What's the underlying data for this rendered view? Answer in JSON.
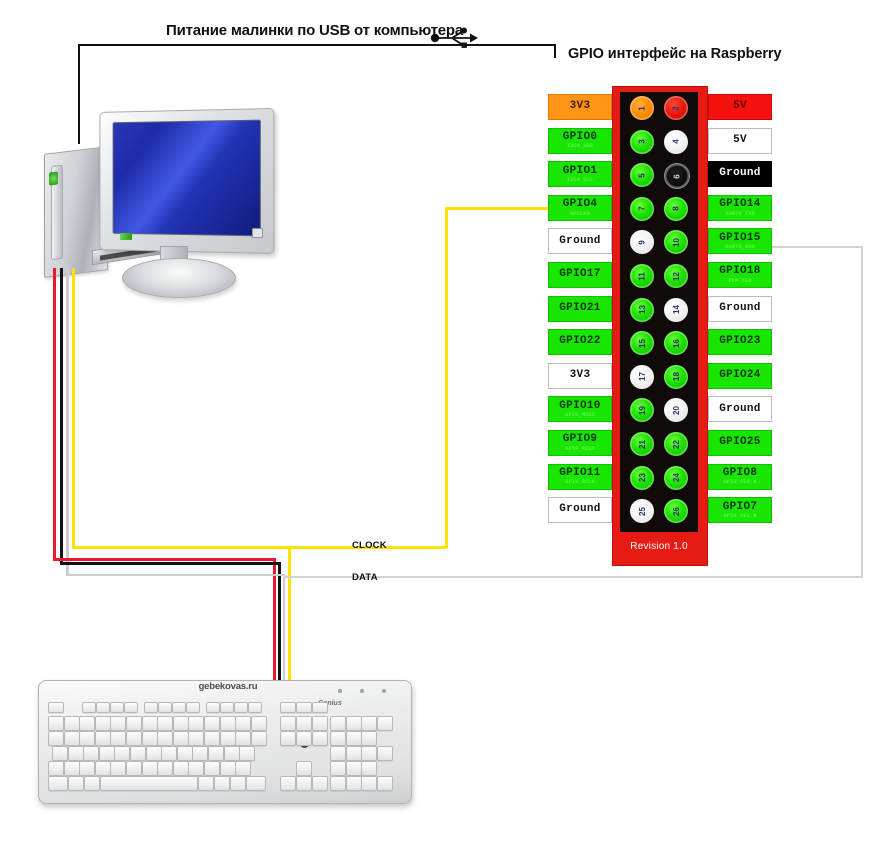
{
  "titles": {
    "usb_power": "Питание малинки по USB от компьютера",
    "gpio_header": "GPIO интерфейс на Raspberry"
  },
  "icons": {
    "usb": "usb-icon"
  },
  "board": {
    "revision": "Revision 1.0",
    "body_color": "#e51b14",
    "inner_color": "#100b09"
  },
  "net_labels": {
    "clock": "CLOCK",
    "data": "DATA"
  },
  "keyboard": {
    "watermark": "gebekovas.ru",
    "brand": "Genius"
  },
  "wire_colors": {
    "red": "#e8192c",
    "black": "#121212",
    "white": "#c9cdd1",
    "yellow": "#ffe200",
    "gray": "#cfd3d6"
  },
  "pins": {
    "left": [
      {
        "num": "1",
        "color": "orange"
      },
      {
        "num": "3",
        "color": "green"
      },
      {
        "num": "5",
        "color": "green"
      },
      {
        "num": "7",
        "color": "green"
      },
      {
        "num": "9",
        "color": "white"
      },
      {
        "num": "11",
        "color": "green"
      },
      {
        "num": "13",
        "color": "green"
      },
      {
        "num": "15",
        "color": "green"
      },
      {
        "num": "17",
        "color": "white"
      },
      {
        "num": "19",
        "color": "green"
      },
      {
        "num": "21",
        "color": "green"
      },
      {
        "num": "23",
        "color": "green"
      },
      {
        "num": "25",
        "color": "white"
      }
    ],
    "right": [
      {
        "num": "2",
        "color": "red"
      },
      {
        "num": "4",
        "color": "white"
      },
      {
        "num": "6",
        "color": "dark"
      },
      {
        "num": "8",
        "color": "green"
      },
      {
        "num": "10",
        "color": "green"
      },
      {
        "num": "12",
        "color": "green"
      },
      {
        "num": "14",
        "color": "white"
      },
      {
        "num": "16",
        "color": "green"
      },
      {
        "num": "18",
        "color": "green"
      },
      {
        "num": "20",
        "color": "white"
      },
      {
        "num": "22",
        "color": "green"
      },
      {
        "num": "24",
        "color": "green"
      },
      {
        "num": "26",
        "color": "green"
      }
    ]
  },
  "labels_left": [
    {
      "main": "3V3",
      "sub": "",
      "style": "lb-orange"
    },
    {
      "main": "GPIO0",
      "sub": "I2C0_SDA",
      "style": "lb-green"
    },
    {
      "main": "GPIO1",
      "sub": "I2C0_SCL",
      "style": "lb-green"
    },
    {
      "main": "GPIO4",
      "sub": "GPCLK0",
      "style": "lb-green"
    },
    {
      "main": "Ground",
      "sub": "",
      "style": "lb-white"
    },
    {
      "main": "GPIO17",
      "sub": "",
      "style": "lb-green"
    },
    {
      "main": "GPIO21",
      "sub": "",
      "style": "lb-green"
    },
    {
      "main": "GPIO22",
      "sub": "",
      "style": "lb-green"
    },
    {
      "main": "3V3",
      "sub": "",
      "style": "lb-white"
    },
    {
      "main": "GPIO10",
      "sub": "SPI0_MOSI",
      "style": "lb-green"
    },
    {
      "main": "GPIO9",
      "sub": "SPI0_MISO",
      "style": "lb-green"
    },
    {
      "main": "GPIO11",
      "sub": "SPI0_SCLK",
      "style": "lb-green"
    },
    {
      "main": "Ground",
      "sub": "",
      "style": "lb-white"
    }
  ],
  "labels_right": [
    {
      "main": "5V",
      "sub": "",
      "style": "lb-red"
    },
    {
      "main": "5V",
      "sub": "",
      "style": "lb-white"
    },
    {
      "main": "Ground",
      "sub": "",
      "style": "lb-black"
    },
    {
      "main": "GPIO14",
      "sub": "UART0_TXD",
      "style": "lb-green"
    },
    {
      "main": "GPIO15",
      "sub": "UART0_RXD",
      "style": "lb-green"
    },
    {
      "main": "GPIO18",
      "sub": "PCM_CLK",
      "style": "lb-green"
    },
    {
      "main": "Ground",
      "sub": "",
      "style": "lb-white"
    },
    {
      "main": "GPIO23",
      "sub": "",
      "style": "lb-green"
    },
    {
      "main": "GPIO24",
      "sub": "",
      "style": "lb-green"
    },
    {
      "main": "Ground",
      "sub": "",
      "style": "lb-white"
    },
    {
      "main": "GPIO25",
      "sub": "",
      "style": "lb-green"
    },
    {
      "main": "GPIO8",
      "sub": "SPI0_CE0_N",
      "style": "lb-green"
    },
    {
      "main": "GPIO7",
      "sub": "SPI0_CE1_N",
      "style": "lb-green"
    }
  ]
}
